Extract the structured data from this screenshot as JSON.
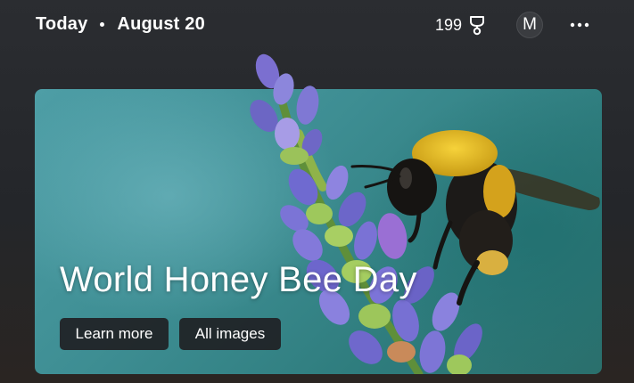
{
  "header": {
    "today_label": "Today",
    "date_label": "August 20",
    "rewards_points": "199",
    "rewards_icon": "trophy-icon",
    "avatar_initial": "M",
    "more_icon": "more-horizontal-icon"
  },
  "hero": {
    "title": "World Honey Bee Day",
    "learn_more_label": "Learn more",
    "all_images_label": "All images",
    "image_subject": "bee-on-lavender-image"
  },
  "colors": {
    "background": "#27292d",
    "card_teal": "#3d8d92",
    "button_bg": "#202124",
    "text": "#ffffff"
  }
}
